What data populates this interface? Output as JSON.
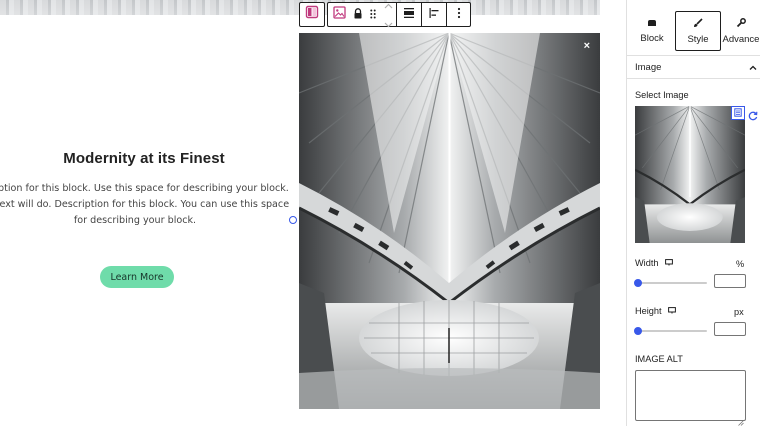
{
  "content": {
    "heading": "Modernity at its Finest",
    "description_lines": [
      "scription for this block. Use this space for describing your block.",
      "ny text will do. Description for this block. You can use this space",
      "for describing your block."
    ],
    "button_label": "Learn More"
  },
  "image": {
    "close_glyph": "×"
  },
  "toolbar": {
    "icons": [
      "block-type-icon",
      "image-icon",
      "lock-icon",
      "drag-handle-icon",
      "move-up-icon",
      "move-down-icon",
      "align-icon",
      "justify-icon",
      "more-options-icon"
    ]
  },
  "sidebar": {
    "tabs": [
      {
        "label": "Block",
        "icon": "block-icon"
      },
      {
        "label": "Style",
        "icon": "brush-icon",
        "active": true
      },
      {
        "label": "Advance",
        "icon": "wrench-icon"
      }
    ],
    "panel_title": "Image",
    "select_image_label": "Select Image",
    "width_label": "Width",
    "width_unit": "%",
    "width_value": "",
    "height_label": "Height",
    "height_unit": "px",
    "height_value": "",
    "alt_label": "IMAGE ALT",
    "alt_value": ""
  },
  "colors": {
    "accent": "#3858e9",
    "button_bg": "#6fdcaa",
    "block_type_icon": "#c0397e"
  }
}
